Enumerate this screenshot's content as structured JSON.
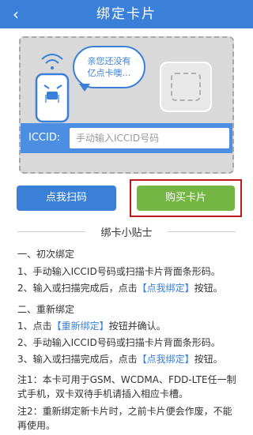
{
  "header": {
    "title": "绑定卡片",
    "back_icon": "chevron-left-icon"
  },
  "card": {
    "bubble_line1": "亲您还没有",
    "bubble_line2": "亿点卡噢…",
    "iccid_label": "ICCID:",
    "iccid_placeholder": "手动输入ICCID号码"
  },
  "buttons": {
    "scan": "点我扫码",
    "buy": "购买卡片"
  },
  "tips": {
    "title": "绑卡小贴士",
    "sec1_title": "一、初次绑定",
    "sec1_l1": "1、手动输入ICCID号码或扫描卡片背面条形码。",
    "sec1_l2_a": "2、输入或扫描完成后，点击",
    "sec1_l2_b": "【点我绑定】",
    "sec1_l2_c": "按钮。",
    "sec2_title": "二、重新绑定",
    "sec2_l1_a": "1、点击",
    "sec2_l1_b": "【重新绑定】",
    "sec2_l1_c": "按钮并确认。",
    "sec2_l2": "2、手动输入ICCID号码或扫描卡片背面条形码。",
    "sec2_l3_a": "3、输入或扫描完成后，点击",
    "sec2_l3_b": "【点我绑定】",
    "sec2_l3_c": "按钮。",
    "note1": "注1：本卡可用于GSM、WCDMA、FDD-LTE任一制式手机，双卡双待手机请插入相应卡槽。",
    "note2": "注2：重新绑定新卡片时，之前卡片便会作废，不能再使用。"
  },
  "colors": {
    "primary": "#3a80d8",
    "green": "#74b643",
    "highlight": "#c0181f"
  }
}
